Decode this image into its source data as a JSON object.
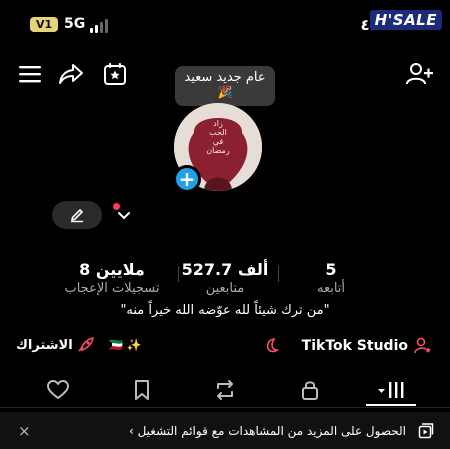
{
  "status_bar": {
    "sim": "V1",
    "network": "5G",
    "time": "٤:٠٣",
    "watermark": "H'SALE"
  },
  "tooltip": {
    "text": "عام جديد سعيد",
    "emoji": "🎉"
  },
  "avatar": {
    "caption_lines": [
      "زاد",
      "الحب",
      "في",
      "رمضان"
    ],
    "add_symbol": "+"
  },
  "stats": [
    {
      "value": "8 ملايين",
      "label": "تسجيلات الإعجاب"
    },
    {
      "value": "527.7 ألف",
      "label": "متابعين"
    },
    {
      "value": "5",
      "label": "أتابعه"
    }
  ],
  "bio": "\"من ترك شيئاً لله عوّضه الله خيراً منه\"",
  "links": {
    "subscribe_label": "الاشتراك",
    "flags": "🇰🇼 ✨",
    "tiktok_studio_label": "TikTok Studio"
  },
  "banner": {
    "text": "الحصول على المزيد من المشاهدات مع قوائم التشغيل",
    "chevron": "›",
    "close": "×"
  },
  "colors": {
    "accent_blue": "#20a0e8",
    "accent_red": "#ff3b5c",
    "avatar_red": "#8b2030"
  }
}
